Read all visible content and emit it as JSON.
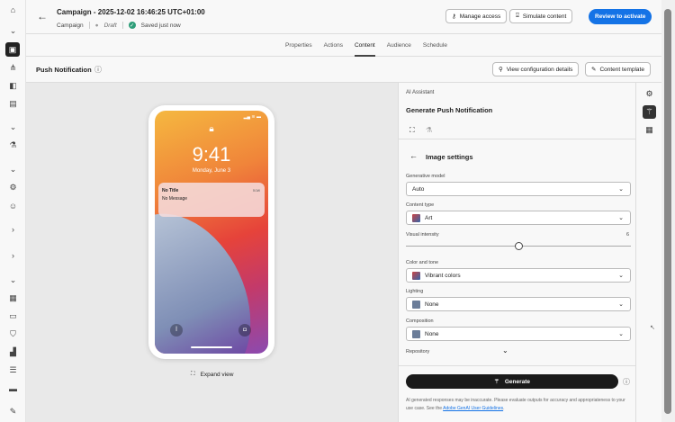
{
  "header": {
    "title": "Campaign - 2025-12-02 16:46:25 UTC+01:00",
    "type": "Campaign",
    "status": "Draft",
    "saved": "Saved just now",
    "manage_access": "Manage access",
    "simulate": "Simulate content",
    "review": "Review to activate"
  },
  "tabs": [
    "Properties",
    "Actions",
    "Content",
    "Audience",
    "Schedule"
  ],
  "section": {
    "title": "Push Notification",
    "view_config": "View configuration details",
    "content_template": "Content template"
  },
  "preview": {
    "time": "9:41",
    "date": "Monday, June 3",
    "notif_title": "No Title",
    "notif_time": "now",
    "notif_message": "No Message",
    "expand": "Expand view"
  },
  "assistant": {
    "label": "AI Assistant",
    "title": "Generate Push Notification",
    "settings_title": "Image settings",
    "generative_model_label": "Generative model",
    "generative_model": "Auto",
    "content_type_label": "Content type",
    "content_type": "Art",
    "visual_intensity_label": "Visual intensity",
    "visual_intensity": "6",
    "visual_intensity_fraction": 0.5,
    "color_label": "Color and tone",
    "color": "Vibrant colors",
    "lighting_label": "Lighting",
    "lighting": "None",
    "composition_label": "Composition",
    "composition": "None",
    "repository_label": "Repository",
    "generate": "Generate",
    "disclaimer": "AI generated responses may be inaccurate. Please evaluate outputs for accuracy and appropriateness to your use case. See the ",
    "guidelines_link": "Adobe GenAI User Guidelines"
  },
  "colors": {
    "accent": "#1473e6",
    "generate": "#1a1a1a"
  }
}
